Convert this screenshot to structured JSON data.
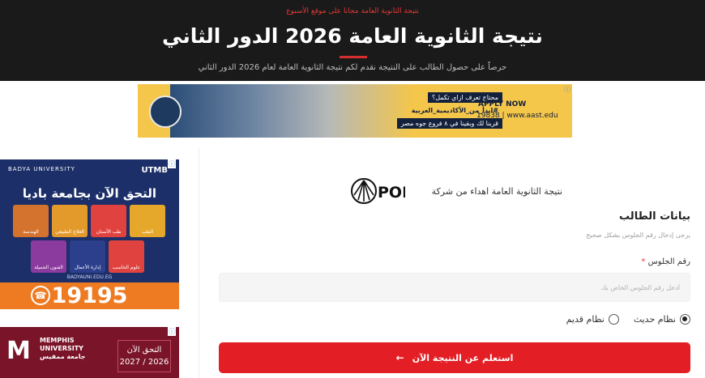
{
  "header": {
    "topline": "نتيجة الثانوية العامة مجانا على موقع الأسبوع",
    "title": "نتيجة الثانوية العامة 2026 الدور الثاني",
    "subtitle": "حرصاً على حصول الطالب على النتيجة نقدم لكم نتيجة الثانوية العامة لعام 2026 الدور الثاني"
  },
  "ad_top": {
    "tag1": "محتاج تعرف ازاي تكمل؟",
    "tag2": "#ابدأ_من_الأكاديمية_العربية",
    "tag3": "قربنا لك وبقينا في ٨ فروع جوه مصر",
    "apply": "APPLY NOW",
    "phone": "19838 | www.aast.edu",
    "info_icon": "info-icon"
  },
  "ad_badya": {
    "brand": "BADYA UNIVERSITY",
    "partner": "UTMB",
    "headline": "التحق الآن بجامعة باديا",
    "tiles": [
      {
        "label": "الطب",
        "color": "#e6a82b"
      },
      {
        "label": "طب الأسنان",
        "color": "#e0433f"
      },
      {
        "label": "العلاج الطبيعي",
        "color": "#e39a2a"
      },
      {
        "label": "الهندسة",
        "color": "#d4732d"
      }
    ],
    "tiles2": [
      {
        "label": "علوم الحاسب",
        "color": "#e0433f"
      },
      {
        "label": "إدارة الأعمال",
        "color": "#2b3f8c"
      },
      {
        "label": "الفنون الجميلة",
        "color": "#8b3a9e"
      }
    ],
    "site": "BADYAUNI.EDU.EG",
    "hotline": "19195"
  },
  "ad_memphis": {
    "name_line1": "MEMPHIS",
    "name_line2": "UNIVERSITY",
    "name_line3": "جامعة ممفيس",
    "cta_line1": "التحق الآن",
    "cta_line2": "2026 / 2027"
  },
  "form": {
    "partner_text": "نتيجة الثانوية العامة اهداء من شركة",
    "partner_logo": "POD",
    "section_title": "بيانات الطالب",
    "section_sub": "يرجى إدخال رقم الجلوس بشكل صحيح",
    "seat_label": "رقم الجلوس",
    "seat_required_mark": "*",
    "seat_placeholder": "أدخل رقم الجلوس الخاص بك",
    "seat_value": "",
    "radio_new": "نظام حديث",
    "radio_old": "نظام قديم",
    "selected_system": "new",
    "submit_label": "استعلم عن النتيجة الآن",
    "submit_icon": "arrow-left-icon"
  },
  "colors": {
    "header_bg": "#1a1a1a",
    "accent_red": "#e31e24"
  }
}
